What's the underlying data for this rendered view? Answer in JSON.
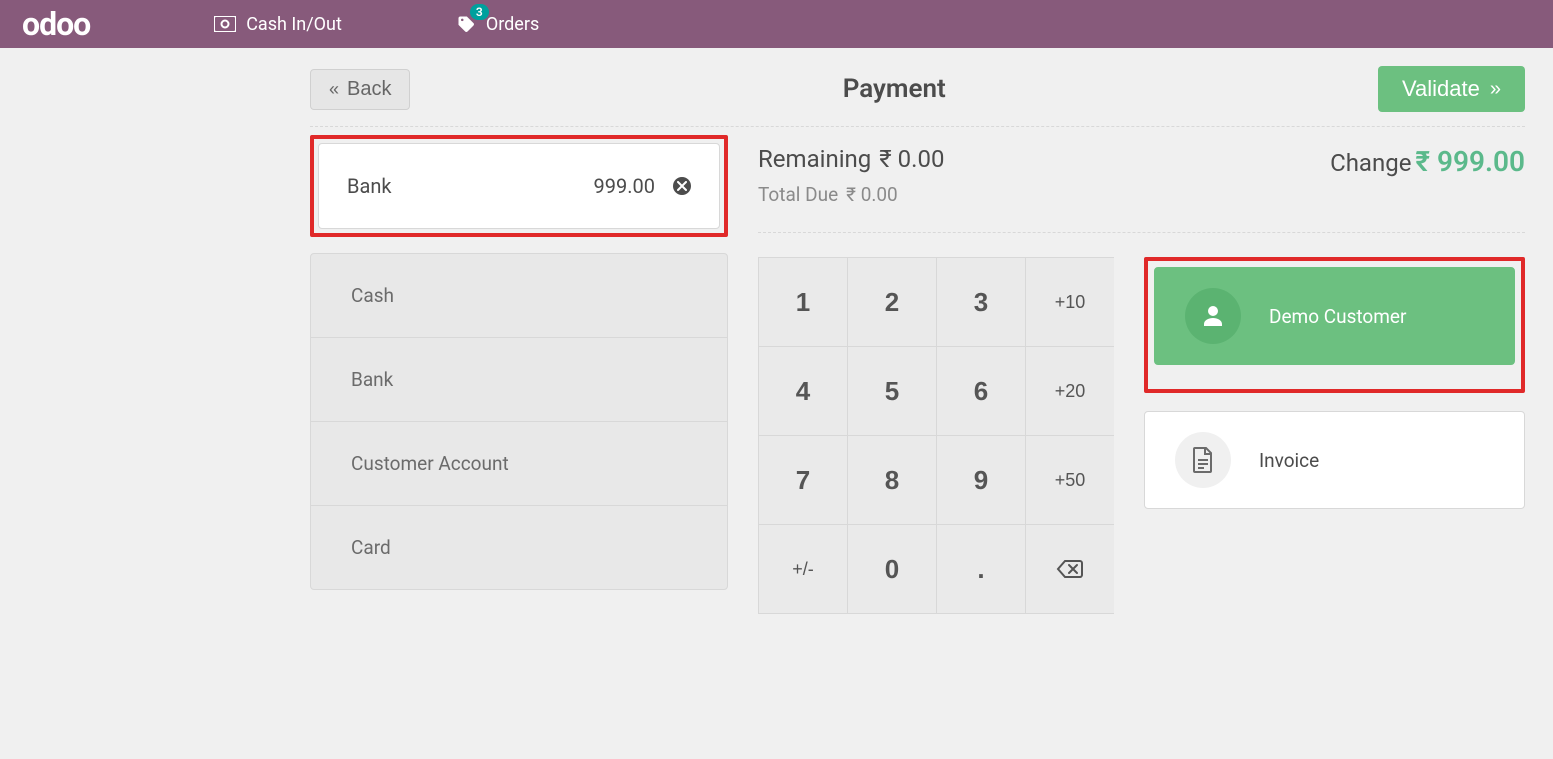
{
  "topbar": {
    "brand": "odoo",
    "cash_label": "Cash In/Out",
    "orders_label": "Orders",
    "orders_badge": "3"
  },
  "header": {
    "back_label": "Back",
    "title": "Payment",
    "validate_label": "Validate"
  },
  "payment_line": {
    "method": "Bank",
    "amount": "999.00"
  },
  "methods": [
    "Cash",
    "Bank",
    "Customer Account",
    "Card"
  ],
  "summary": {
    "remaining_label": "Remaining",
    "remaining_value": "₹ 0.00",
    "total_due_label": "Total Due",
    "total_due_value": "₹ 0.00",
    "change_label": "Change",
    "change_value": "₹ 999.00"
  },
  "numpad": {
    "keys": [
      "1",
      "2",
      "3",
      "+10",
      "4",
      "5",
      "6",
      "+20",
      "7",
      "8",
      "9",
      "+50",
      "+/-",
      "0",
      ".",
      "backspace"
    ]
  },
  "actions": {
    "customer_label": "Demo Customer",
    "invoice_label": "Invoice"
  }
}
